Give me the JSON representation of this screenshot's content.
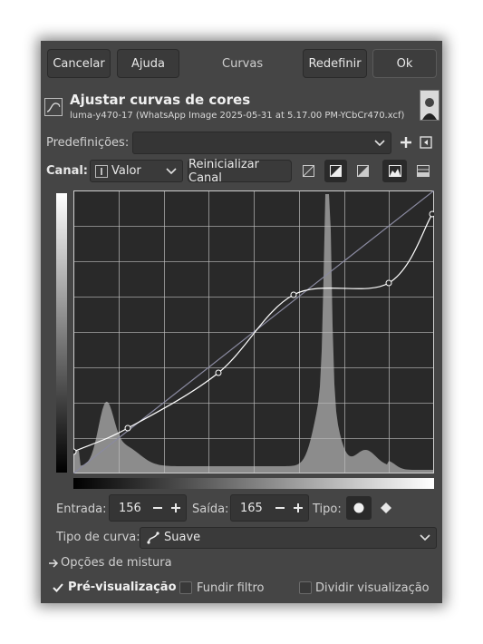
{
  "header": {
    "cancel_label": "Cancelar",
    "help_label": "Ajuda",
    "title": "Curvas",
    "reset_label": "Redefinir",
    "ok_label": "Ok"
  },
  "info": {
    "title": "Ajustar curvas de cores",
    "subtitle": "luma-y470-17 (WhatsApp Image 2025-05-31 at 5.17.00 PM-YCbCr470.xcf)"
  },
  "presets": {
    "label": "Predefinições:",
    "value": ""
  },
  "channel": {
    "label": "Canal:",
    "value": "Valor",
    "reset_label": "Reinicializar Canal"
  },
  "inputs": {
    "entrada_label": "Entrada:",
    "entrada_value": "156",
    "saida_label": "Saída:",
    "saida_value": "165",
    "tipo_label": "Tipo:"
  },
  "curve_type": {
    "label": "Tipo de curva:",
    "value": "Suave"
  },
  "blend_options_label": "Opções de mistura",
  "preview": {
    "label": "Pré-visualização",
    "checked": true
  },
  "merge_filter": {
    "label": "Fundir filtro",
    "checked": false
  },
  "split_view": {
    "label": "Dividir visualização",
    "checked": false
  },
  "curve_points": [
    [
      0,
      24
    ],
    [
      60,
      50
    ],
    [
      160,
      111
    ],
    [
      243,
      197
    ],
    [
      348,
      210
    ],
    [
      396,
      286
    ]
  ],
  "colors": {
    "background": "#454545",
    "plot": "#292929",
    "histogram": "#8c8c8c",
    "curve": "#ffffff",
    "identity": "#8a8aa0"
  }
}
